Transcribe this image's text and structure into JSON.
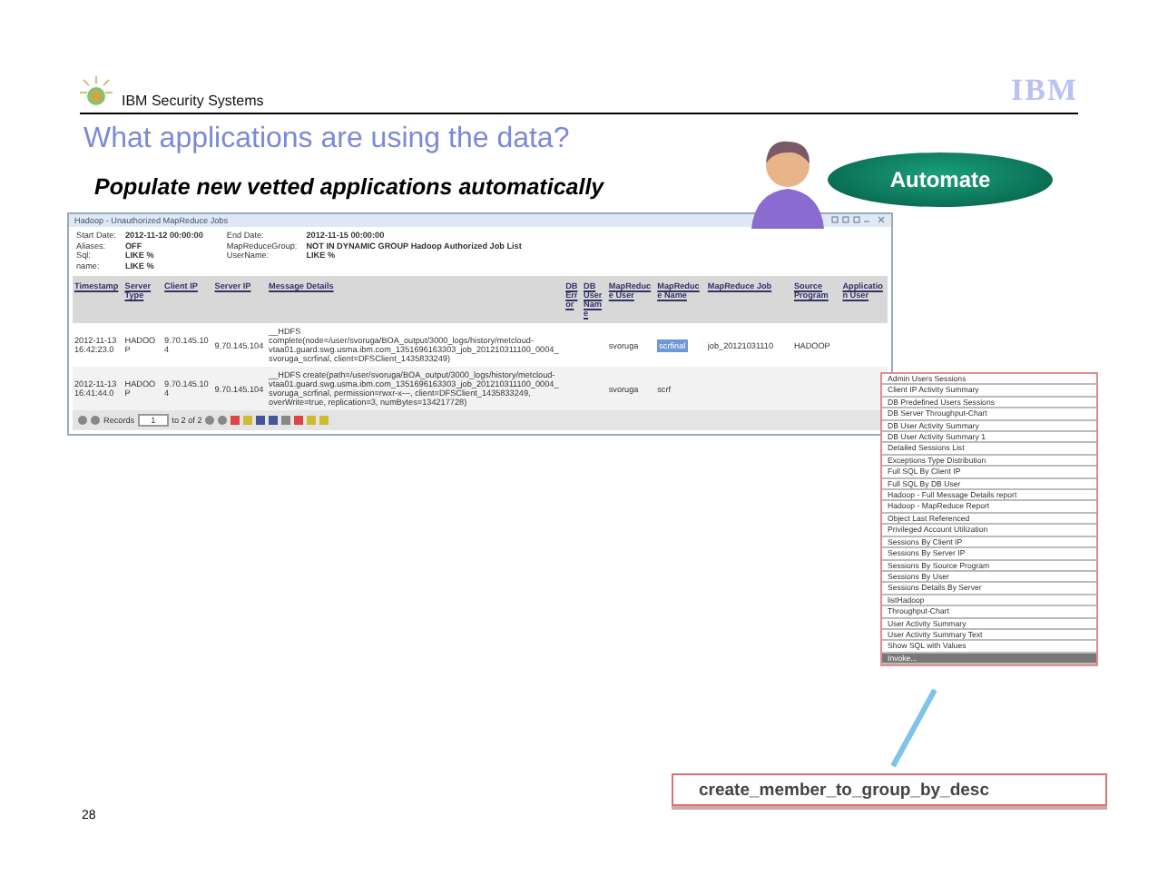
{
  "slide": {
    "brand": "IBM Security Systems",
    "logo": "IBM",
    "title": "What applications are using the data?",
    "subtitle": "Populate new vetted applications automatically",
    "badge": "Automate",
    "page_number": "28",
    "callout": "create_member_to_group_by_desc"
  },
  "app": {
    "title": "Hadoop - Unauthorized MapReduce Jobs",
    "filters": [
      {
        "label": "Start Date:",
        "value": "2012-11-12 00:00:00"
      },
      {
        "label": "End Date:",
        "value": "2012-11-15 00:00:00"
      },
      {
        "label": "Aliases:",
        "value": "OFF"
      },
      {
        "label": "MapReduceGroup:",
        "value": "NOT IN DYNAMIC GROUP Hadoop Authorized Job List"
      },
      {
        "label": "Sql:",
        "value": "LIKE %"
      },
      {
        "label": "UserName:",
        "value": "LIKE %"
      },
      {
        "label": "name:",
        "value": "LIKE %"
      }
    ],
    "columns": [
      "Timestamp",
      "Server Type",
      "Client IP",
      "Server IP",
      "Message Details",
      "DB Error",
      "DB User Name",
      "MapReduce User",
      "MapReduce Name",
      "MapReduce Job",
      "Source Program",
      "Application User"
    ],
    "rows": [
      {
        "cells": [
          {
            "text": "2012-11-13 16:42:23.0",
            "selected": false
          },
          {
            "text": "HADOOP",
            "selected": false
          },
          {
            "text": "9.70.145.104",
            "selected": false
          },
          {
            "text": "9.70.145.104",
            "selected": false
          },
          {
            "text": "__HDFS complete(node=/user/svoruga/BOA_output/3000_logs/history/metcloud-vtaa01.guard.swg.usma.ibm.com_1351696163303_job_201210311100_0004_svoruga_scrfinal, client=DFSClient_1435833249)",
            "selected": false
          },
          {
            "selected": false
          },
          {
            "selected": false
          },
          {
            "text": "svoruga",
            "selected": false
          },
          {
            "text": "scrfinal",
            "selected": true
          },
          {
            "text": "job_20121031110",
            "selected": false
          },
          {
            "text": "HADOOP",
            "selected": false
          },
          {
            "selected": false
          }
        ]
      },
      {
        "cells": [
          {
            "text": "2012-11-13 16:41:44.0",
            "selected": false
          },
          {
            "text": "HADOOP",
            "selected": false
          },
          {
            "text": "9.70.145.104",
            "selected": false
          },
          {
            "text": "9.70.145.104",
            "selected": false
          },
          {
            "text": "__HDFS create(path=/user/svoruga/BOA_output/3000_logs/history/metcloud-vtaa01.guard.swg.usma.ibm.com_1351696163303_job_201210311100_0004_svoruga_scrfinal, permission=rwxr-x---, client=DFSClient_1435833249, overWrite=true, replication=3, numBytes=134217728)",
            "selected": false
          },
          {
            "selected": false
          },
          {
            "selected": false
          },
          {
            "text": "svoruga",
            "selected": false
          },
          {
            "text": "scrf",
            "selected": false
          },
          {
            "selected": false
          },
          {
            "selected": false
          },
          {
            "selected": false
          }
        ]
      }
    ],
    "pager": {
      "label": "Records",
      "page": "1",
      "range": "to 2 of 2"
    },
    "menu": [
      {
        "label": "Admin Users Sessions",
        "selected": false
      },
      {
        "label": "Client IP Activity Summary",
        "selected": false
      },
      {
        "label": "DB Predefined Users Sessions",
        "selected": false
      },
      {
        "label": "DB Server Throughput-Chart",
        "selected": false
      },
      {
        "label": "DB User Activity Summary",
        "selected": false
      },
      {
        "label": "DB User Activity Summary 1",
        "selected": false
      },
      {
        "label": "Detailed Sessions List",
        "selected": false
      },
      {
        "label": "Exceptions Type Distribution",
        "selected": false
      },
      {
        "label": "Full SQL By Client IP",
        "selected": false
      },
      {
        "label": "Full SQL By DB User",
        "selected": false
      },
      {
        "label": "Hadoop - Full Message Details report",
        "selected": false
      },
      {
        "label": "Hadoop - MapReduce Report",
        "selected": false
      },
      {
        "label": "Object Last Referenced",
        "selected": false
      },
      {
        "label": "Privileged Account Utilization",
        "selected": false
      },
      {
        "label": "Sessions By Client IP",
        "selected": false
      },
      {
        "label": "Sessions By Server IP",
        "selected": false
      },
      {
        "label": "Sessions By Source Program",
        "selected": false
      },
      {
        "label": "Sessions By User",
        "selected": false
      },
      {
        "label": "Sessions Details By Server",
        "selected": false
      },
      {
        "label": "listHadoop",
        "selected": false
      },
      {
        "label": "Throughput-Chart",
        "selected": false
      },
      {
        "label": "User Activity Summary",
        "selected": false
      },
      {
        "label": "User Activity Summary Text",
        "selected": false
      },
      {
        "label": "Show SQL with Values",
        "selected": false
      },
      {
        "label": "Invoke...",
        "selected": true
      }
    ]
  }
}
